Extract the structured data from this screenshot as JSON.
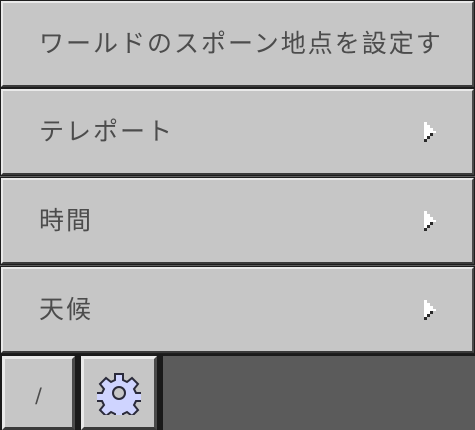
{
  "menu": {
    "items": [
      {
        "label": "ワールドのスポーン地点を設定す",
        "has_submenu": false
      },
      {
        "label": "テレポート",
        "has_submenu": true
      },
      {
        "label": "時間",
        "has_submenu": true
      },
      {
        "label": "天候",
        "has_submenu": true
      }
    ]
  },
  "bottom_bar": {
    "slash_label": "/",
    "settings_icon": "gear-icon"
  }
}
